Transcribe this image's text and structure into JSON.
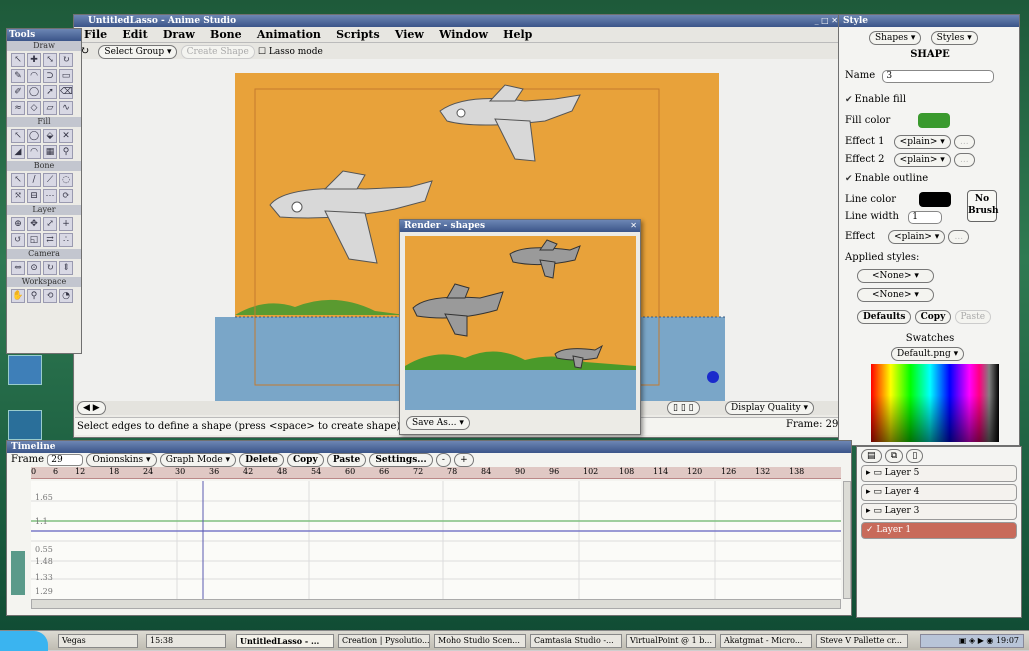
{
  "main_window": {
    "title": "UntitledLasso - Anime Studio",
    "menu": [
      "File",
      "Edit",
      "Draw",
      "Bone",
      "Animation",
      "Scripts",
      "View",
      "Window",
      "Help"
    ],
    "toolbar": {
      "select_group": "Select Group",
      "create_shape": "Create Shape",
      "lasso_mode": "Lasso mode"
    },
    "status_text": "Select edges to define a shape (press <space> to create shape), hold <ctrl> to toggle lasso.",
    "status_tail": "Frame: 29",
    "display_quality": "Display Quality"
  },
  "tools_panel": {
    "title": "Tools",
    "sections": [
      "Draw",
      "Fill",
      "Bone",
      "Layer",
      "Camera",
      "Workspace"
    ]
  },
  "preview_window": {
    "title": "Render - shapes",
    "save_as": "Save As..."
  },
  "timeline": {
    "title": "Timeline",
    "frame_label": "Frame",
    "frame_value": "29",
    "onionskins": "Onionskins",
    "graph_mode": "Graph Mode",
    "delete": "Delete",
    "copy": "Copy",
    "paste": "Paste",
    "settings": "Settings...",
    "ruler": [
      "0",
      "6",
      "12",
      "18",
      "24",
      "30",
      "36",
      "42",
      "48",
      "54",
      "60",
      "66",
      "72",
      "78",
      "84",
      "90",
      "96",
      "102",
      "108",
      "114",
      "120",
      "126",
      "132",
      "138"
    ],
    "y_values": [
      "1.65",
      "1.1",
      "0.55",
      "1.48",
      "1.33",
      "1.29"
    ]
  },
  "style_panel": {
    "title": "Style",
    "shapes_dd": "Shapes",
    "styles_dd": "Styles",
    "heading": "SHAPE",
    "name_label": "Name",
    "name_value": "3",
    "enable_fill": "Enable fill",
    "fill_color_label": "Fill color",
    "fill_color": "#3a9a2e",
    "effect1_label": "Effect 1",
    "effect2_label": "Effect 2",
    "plain": "<plain>",
    "enable_outline": "Enable outline",
    "line_color_label": "Line color",
    "line_color": "#000000",
    "no_brush": "No Brush",
    "line_width_label": "Line width",
    "line_width_value": "1",
    "effect_label": "Effect",
    "applied_styles": "Applied styles:",
    "none": "<None>",
    "defaults": "Defaults",
    "copy": "Copy",
    "paste": "Paste",
    "swatches": "Swatches",
    "swatch_file": "Default.png"
  },
  "layers_panel": {
    "layers": [
      "Layer 5",
      "Layer 4",
      "Layer 3",
      "Layer 1"
    ]
  },
  "taskbar": {
    "items": [
      "Vegas",
      "15:38",
      "UntitledLasso - ...",
      "Creation | Pysolutio...",
      "Moho Studio Scen...",
      "Camtasia Studio -...",
      "VirtualPoint @ 1 b...",
      "Akatgmat - Micro...",
      "Steve V Pallette cr..."
    ],
    "clock": "19:07"
  },
  "colors": {
    "sky": "#e8a23a",
    "water": "#7aa6c8",
    "grass": "#5a9a30",
    "plane": "#d8d8d8"
  }
}
